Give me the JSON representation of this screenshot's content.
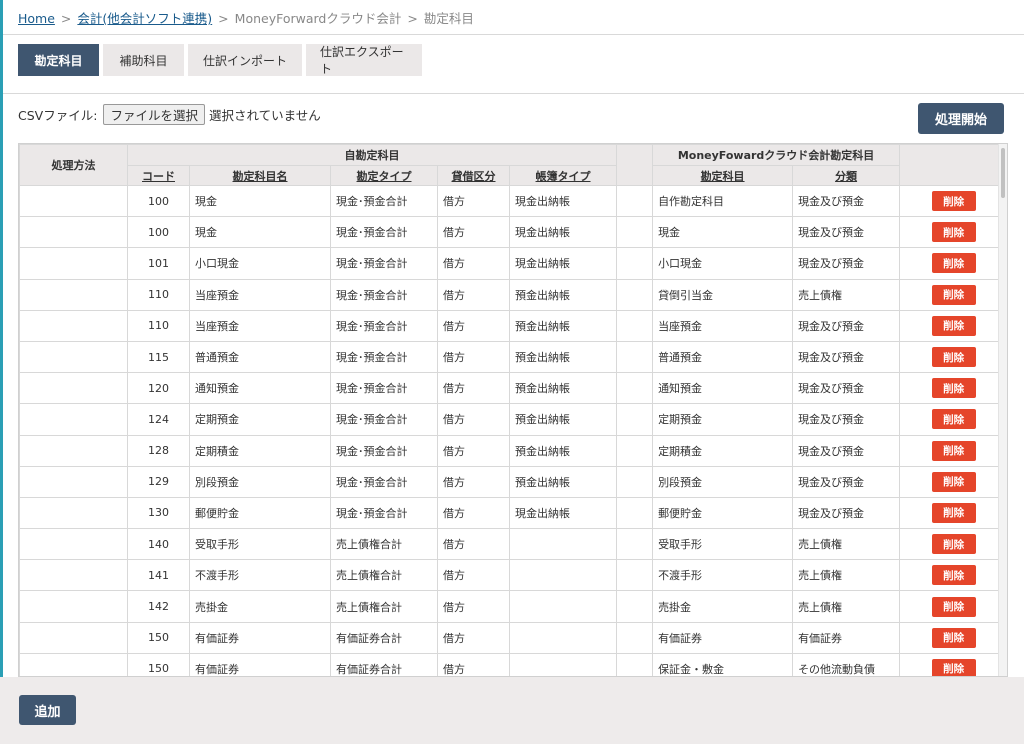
{
  "breadcrumb": {
    "home": "Home",
    "sep": ">",
    "link2": "会計(他会計ソフト連携)",
    "item3": "MoneyForwardクラウド会計",
    "item4": "勘定科目"
  },
  "tabs": [
    {
      "label": "勘定科目",
      "active": true
    },
    {
      "label": "補助科目",
      "active": false
    },
    {
      "label": "仕訳インポート",
      "active": false
    },
    {
      "label": "仕訳エクスポート",
      "active": false
    }
  ],
  "csv": {
    "label": "CSVファイル:",
    "button": "ファイルを選択",
    "status": "選択されていません"
  },
  "start_button": "処理開始",
  "table": {
    "col_method": "処理方法",
    "group_own": "自勘定科目",
    "group_mf": "MoneyFowardクラウド会計勘定科目",
    "headers": [
      "コード",
      "勘定科目名",
      "勘定タイプ",
      "貸借区分",
      "帳簿タイプ",
      "勘定科目",
      "分類"
    ],
    "delete_label": "削除",
    "rows": [
      {
        "method": "",
        "code": "100",
        "name": "現金",
        "type": "現金･預金合計",
        "side": "借方",
        "book": "現金出納帳",
        "mf_account": "自作勘定科目",
        "mf_class": "現金及び預金"
      },
      {
        "method": "",
        "code": "100",
        "name": "現金",
        "type": "現金･預金合計",
        "side": "借方",
        "book": "現金出納帳",
        "mf_account": "現金",
        "mf_class": "現金及び預金"
      },
      {
        "method": "",
        "code": "101",
        "name": "小口現金",
        "type": "現金･預金合計",
        "side": "借方",
        "book": "現金出納帳",
        "mf_account": "小口現金",
        "mf_class": "現金及び預金"
      },
      {
        "method": "",
        "code": "110",
        "name": "当座預金",
        "type": "現金･預金合計",
        "side": "借方",
        "book": "預金出納帳",
        "mf_account": "貸倒引当金",
        "mf_class": "売上債権"
      },
      {
        "method": "",
        "code": "110",
        "name": "当座預金",
        "type": "現金･預金合計",
        "side": "借方",
        "book": "預金出納帳",
        "mf_account": "当座預金",
        "mf_class": "現金及び預金"
      },
      {
        "method": "",
        "code": "115",
        "name": "普通預金",
        "type": "現金･預金合計",
        "side": "借方",
        "book": "預金出納帳",
        "mf_account": "普通預金",
        "mf_class": "現金及び預金"
      },
      {
        "method": "",
        "code": "120",
        "name": "通知預金",
        "type": "現金･預金合計",
        "side": "借方",
        "book": "預金出納帳",
        "mf_account": "通知預金",
        "mf_class": "現金及び預金"
      },
      {
        "method": "",
        "code": "124",
        "name": "定期預金",
        "type": "現金･預金合計",
        "side": "借方",
        "book": "預金出納帳",
        "mf_account": "定期預金",
        "mf_class": "現金及び預金"
      },
      {
        "method": "",
        "code": "128",
        "name": "定期積金",
        "type": "現金･預金合計",
        "side": "借方",
        "book": "預金出納帳",
        "mf_account": "定期積金",
        "mf_class": "現金及び預金"
      },
      {
        "method": "",
        "code": "129",
        "name": "別段預金",
        "type": "現金･預金合計",
        "side": "借方",
        "book": "預金出納帳",
        "mf_account": "別段預金",
        "mf_class": "現金及び預金"
      },
      {
        "method": "",
        "code": "130",
        "name": "郵便貯金",
        "type": "現金･預金合計",
        "side": "借方",
        "book": "現金出納帳",
        "mf_account": "郵便貯金",
        "mf_class": "現金及び預金"
      },
      {
        "method": "",
        "code": "140",
        "name": "受取手形",
        "type": "売上債権合計",
        "side": "借方",
        "book": "",
        "mf_account": "受取手形",
        "mf_class": "売上債権"
      },
      {
        "method": "",
        "code": "141",
        "name": "不渡手形",
        "type": "売上債権合計",
        "side": "借方",
        "book": "",
        "mf_account": "不渡手形",
        "mf_class": "売上債権"
      },
      {
        "method": "",
        "code": "142",
        "name": "売掛金",
        "type": "売上債権合計",
        "side": "借方",
        "book": "",
        "mf_account": "売掛金",
        "mf_class": "売上債権"
      },
      {
        "method": "",
        "code": "150",
        "name": "有価証券",
        "type": "有価証券合計",
        "side": "借方",
        "book": "",
        "mf_account": "有価証券",
        "mf_class": "有価証券"
      },
      {
        "method": "",
        "code": "150",
        "name": "有価証券",
        "type": "有価証券合計",
        "side": "借方",
        "book": "",
        "mf_account": "保証金・敷金",
        "mf_class": "その他流動負債"
      }
    ]
  },
  "add_button": "追加",
  "colors": {
    "primary": "#3f5670",
    "danger": "#e5452a",
    "accent": "#2a9fb5",
    "header_bg": "#ebe8e8",
    "footer_bg": "#eeebeb"
  }
}
